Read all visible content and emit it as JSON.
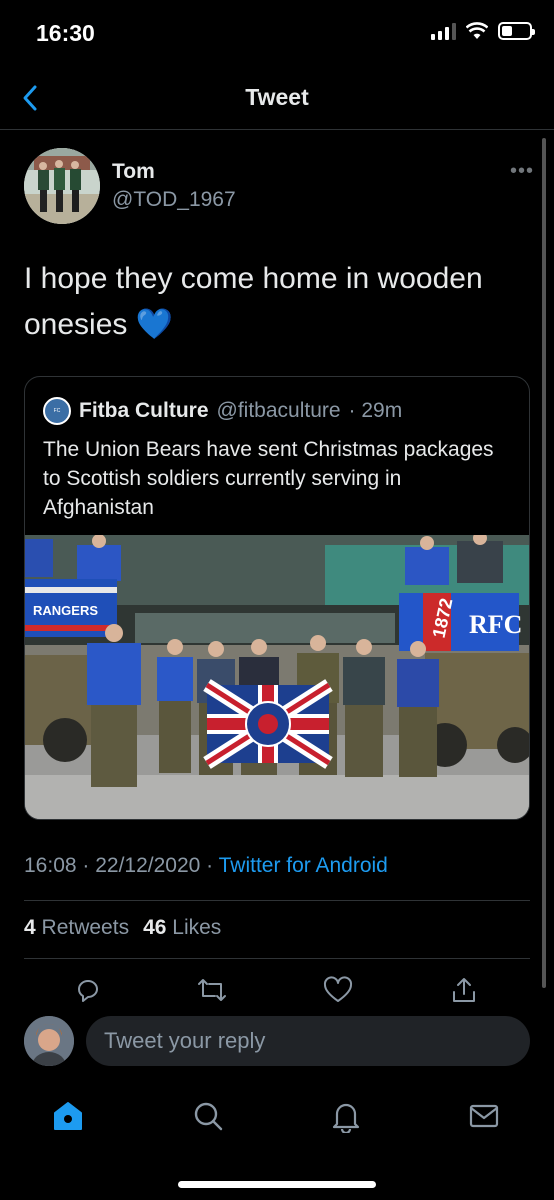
{
  "status_bar": {
    "time": "16:30"
  },
  "nav": {
    "title": "Tweet"
  },
  "tweet": {
    "author_name": "Tom",
    "author_handle": "@TOD_1967",
    "text": "I hope they come home in wooden onesies 💙",
    "timestamp": "16:08 · 22/12/2020 · ",
    "source": "Twitter for Android",
    "retweets_count": "4",
    "retweets_label": "Retweets",
    "likes_count": "46",
    "likes_label": "Likes"
  },
  "quote": {
    "author_name": "Fitba Culture",
    "author_handle": "@fitbaculture",
    "time_ago": "· 29m",
    "text": "The Union Bears have sent Christmas packages to Scottish soldiers currently serving in Afghanistan",
    "image_banner_text": "RANGERS",
    "image_banner_year": "1872"
  },
  "reply": {
    "placeholder": "Tweet your reply"
  },
  "colors": {
    "background": "#000000",
    "accent": "#1d9bf0",
    "secondary_text": "#8b98a5",
    "divider": "#2f3336"
  },
  "icons": {
    "actions": [
      "reply-icon",
      "retweet-icon",
      "like-icon",
      "share-icon"
    ],
    "tabs": [
      "home-icon",
      "search-icon",
      "notifications-icon",
      "messages-icon"
    ]
  }
}
